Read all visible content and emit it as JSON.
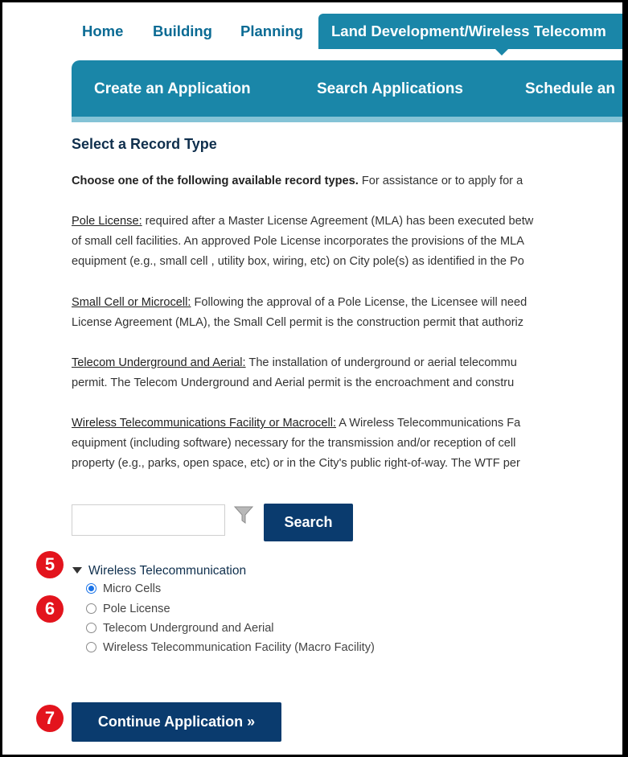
{
  "top_tabs": [
    {
      "label": "Home"
    },
    {
      "label": "Building"
    },
    {
      "label": "Planning"
    },
    {
      "label": "Land Development/Wireless Telecomm"
    }
  ],
  "subnav": [
    "Create an Application",
    "Search Applications",
    "Schedule an"
  ],
  "heading": "Select a Record Type",
  "intro": {
    "bold": "Choose one of the following available record types.",
    "rest": " For assistance or to apply for a"
  },
  "descriptions": [
    {
      "title": "Pole License:",
      "lines": [
        " required after a Master License Agreement (MLA) has been executed betw",
        "of small cell facilities.  An approved Pole License incorporates the provisions of the MLA",
        "equipment (e.g., small cell , utility box, wiring, etc) on City pole(s) as identified in the Po"
      ]
    },
    {
      "title": "Small Cell or Microcell:",
      "lines": [
        " Following the approval of a Pole License, the Licensee will need",
        "License Agreement (MLA), the Small Cell permit is the construction permit that authoriz"
      ]
    },
    {
      "title": "Telecom Underground and Aerial:",
      "lines": [
        " The installation of underground or aerial telecommu",
        "permit.  The Telecom Underground and Aerial permit is the encroachment and constru"
      ]
    },
    {
      "title": "Wireless Telecommunications Facility or Macrocell:",
      "lines": [
        " A Wireless Telecommunications Fa",
        "equipment (including software) necessary for the transmission and/or reception of cell",
        "property (e.g., parks, open space, etc) or in the City's public right-of-way.  The WTF per"
      ]
    }
  ],
  "search": {
    "placeholder": "",
    "button_label": "Search"
  },
  "tree": {
    "group_label": "Wireless Telecommunication",
    "options": [
      {
        "label": "Micro Cells",
        "checked": true
      },
      {
        "label": "Pole License",
        "checked": false
      },
      {
        "label": "Telecom Underground and Aerial",
        "checked": false
      },
      {
        "label": "Wireless Telecommunication Facility (Macro Facility)",
        "checked": false
      }
    ]
  },
  "continue_label": "Continue Application »",
  "callouts": [
    "5",
    "6",
    "7"
  ],
  "colors": {
    "nav": "#1a86a8",
    "button": "#0a3b6e",
    "callout": "#e3141d",
    "link": "#0b6b94"
  }
}
